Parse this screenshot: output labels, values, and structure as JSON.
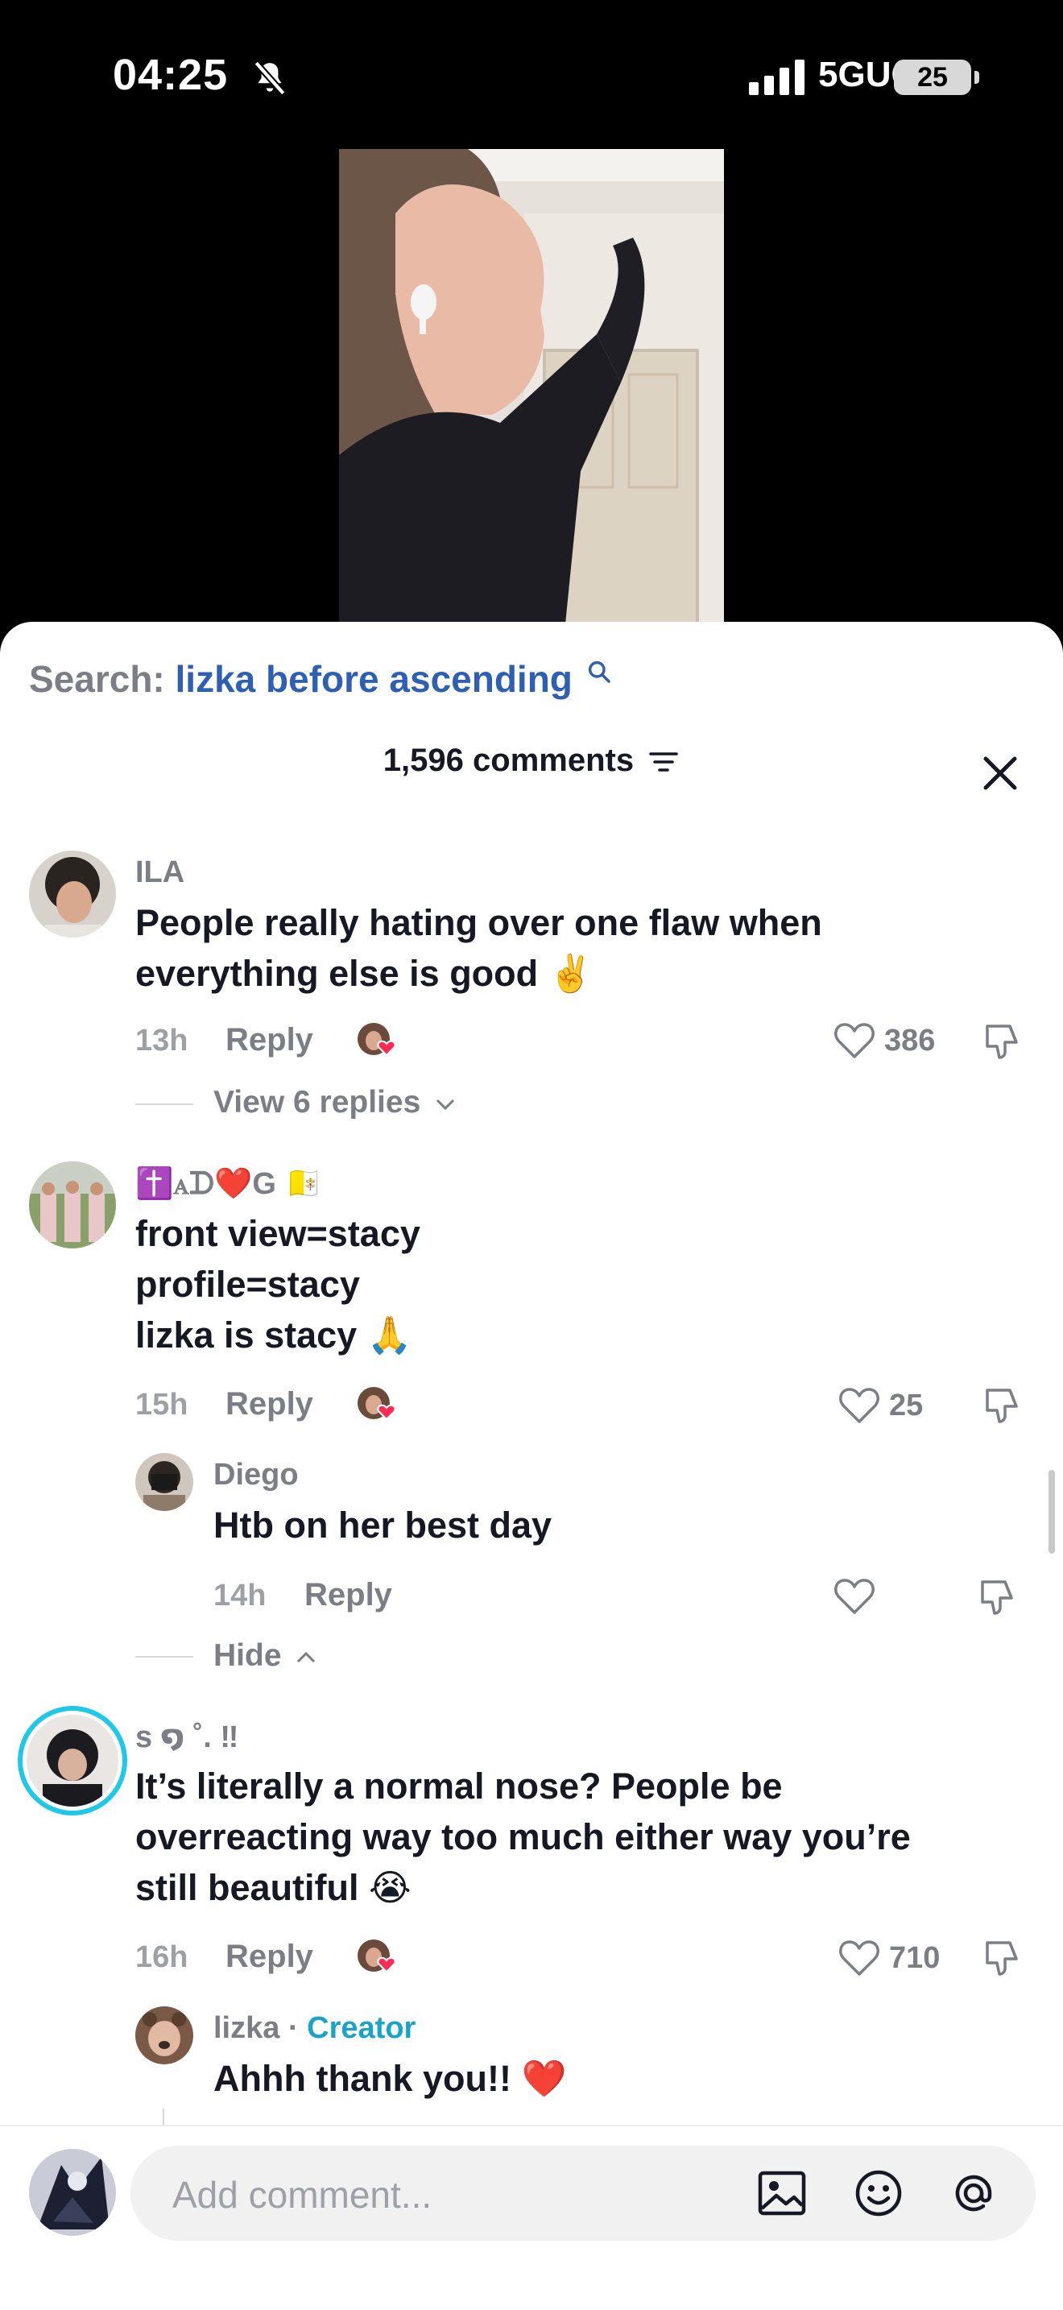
{
  "status_bar": {
    "time": "04:25",
    "network": "5GUC",
    "battery": "25"
  },
  "sheet": {
    "search_label": "Search:",
    "search_query": "lizka before ascending",
    "comments_count": "1,596 comments"
  },
  "comments": [
    {
      "username": "ILA",
      "lines": [
        "People really hating over one flaw when",
        "everything else is good ✌️"
      ],
      "time": "13h",
      "reply_label": "Reply",
      "likes": "386",
      "view_replies": "View 6 replies"
    },
    {
      "username": "✝️ꭺᗪ❤️G 🇻🇦",
      "lines": [
        "front view=stacy",
        "profile=stacy",
        "lizka is stacy 🙏"
      ],
      "time": "15h",
      "reply_label": "Reply",
      "likes": "25",
      "hide_label": "Hide"
    },
    {
      "username": "s ໑ ˚. ‼",
      "lines": [
        "It’s literally a normal nose? People be",
        "overreacting way too much either way you’re",
        "still beautiful 😭"
      ],
      "time": "16h",
      "reply_label": "Reply",
      "likes": "710"
    }
  ],
  "replies": [
    {
      "username": "Diego",
      "text": "Htb on her best day",
      "time": "14h",
      "reply_label": "Reply"
    },
    {
      "username": "lizka",
      "separator": "·",
      "badge": "Creator",
      "text": "Ahhh thank you!! ❤️"
    }
  ],
  "composer": {
    "placeholder": "Add comment..."
  },
  "colors": {
    "accent_link": "#2f5fb3",
    "creator_badge": "#1aa3c9",
    "story_ring": "#1ec8e6"
  }
}
